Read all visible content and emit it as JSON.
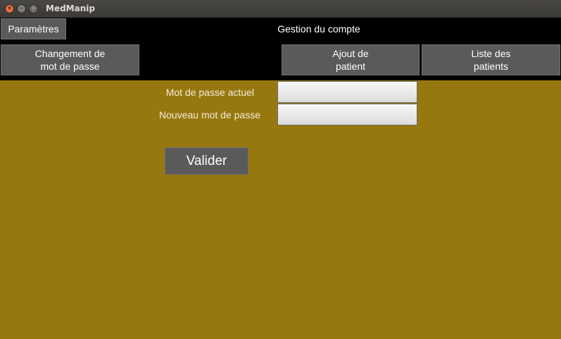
{
  "window": {
    "title": "MedManip",
    "close_glyph": "×",
    "min_glyph": "–",
    "max_glyph": "□"
  },
  "header": {
    "settings_label": "Paramètres",
    "section_title": "Gestion du compte"
  },
  "nav": {
    "change_password": "Changement de\nmot de passe",
    "add_patient": "Ajout de\npatient",
    "patient_list": "Liste des\npatients"
  },
  "form": {
    "current_password_label": "Mot de passe actuel",
    "current_password_value": "",
    "new_password_label": "Nouveau mot de passe",
    "new_password_value": "",
    "submit_label": "Valider"
  },
  "colors": {
    "background": "#97780f",
    "header": "#000000",
    "button": "#5a5a5a"
  }
}
